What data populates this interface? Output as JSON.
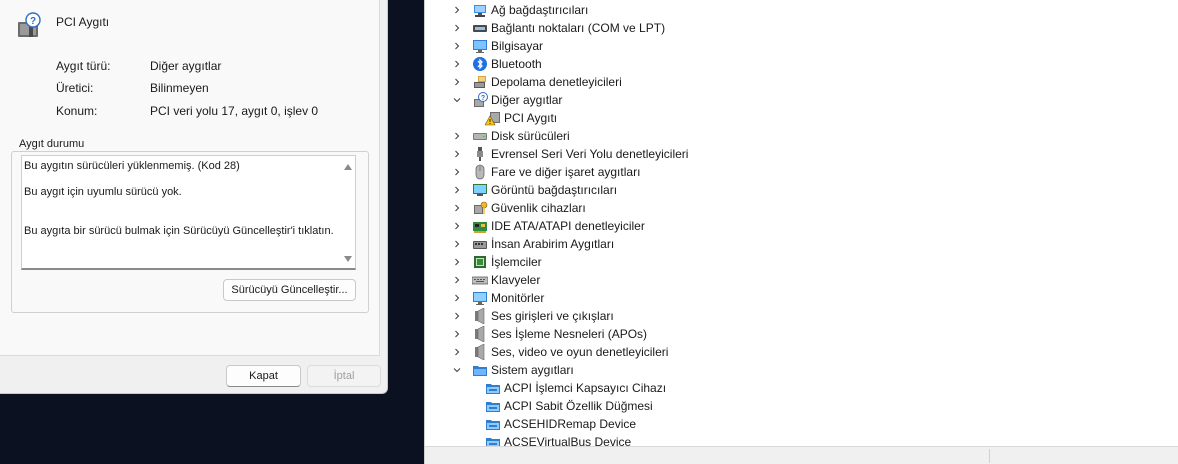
{
  "dialog": {
    "device_name": "PCI Aygıtı",
    "properties": [
      {
        "key": "Aygıt türü:",
        "value": "Diğer aygıtlar"
      },
      {
        "key": "Üretici:",
        "value": "Bilinmeyen"
      },
      {
        "key": "Konum:",
        "value": "PCI veri yolu 17, aygıt 0, işlev 0"
      }
    ],
    "status_group_title": "Aygıt durumu",
    "status_lines": [
      "Bu aygıtın sürücüleri yüklenmemiş. (Kod 28)",
      "Bu aygıt için uyumlu sürücü yok.",
      "Bu aygıta bir sürücü bulmak için Sürücüyü Güncelleştir'i tıklatın."
    ],
    "update_driver_label": "Sürücüyü Güncelleştir...",
    "close_label": "Kapat",
    "cancel_label": "İptal"
  },
  "device_manager": {
    "tree": [
      {
        "label": "Ağ bağdaştırıcıları",
        "icon": "network-adapter-icon",
        "level": 0,
        "state": "collapsed"
      },
      {
        "label": "Bağlantı noktaları (COM ve LPT)",
        "icon": "port-icon",
        "level": 0,
        "state": "collapsed"
      },
      {
        "label": "Bilgisayar",
        "icon": "computer-icon",
        "level": 0,
        "state": "collapsed"
      },
      {
        "label": "Bluetooth",
        "icon": "bluetooth-icon",
        "level": 0,
        "state": "collapsed"
      },
      {
        "label": "Depolama denetleyicileri",
        "icon": "storage-controller-icon",
        "level": 0,
        "state": "collapsed"
      },
      {
        "label": "Diğer aygıtlar",
        "icon": "unknown-device-icon",
        "level": 0,
        "state": "expanded"
      },
      {
        "label": "PCI Aygıtı",
        "icon": "warning-device-icon",
        "level": 1,
        "state": "leaf"
      },
      {
        "label": "Disk sürücüleri",
        "icon": "disk-drive-icon",
        "level": 0,
        "state": "collapsed"
      },
      {
        "label": "Evrensel Seri Veri Yolu denetleyicileri",
        "icon": "usb-icon",
        "level": 0,
        "state": "collapsed"
      },
      {
        "label": "Fare ve diğer işaret aygıtları",
        "icon": "mouse-icon",
        "level": 0,
        "state": "collapsed"
      },
      {
        "label": "Görüntü bağdaştırıcıları",
        "icon": "display-adapter-icon",
        "level": 0,
        "state": "collapsed"
      },
      {
        "label": "Güvenlik cihazları",
        "icon": "security-device-icon",
        "level": 0,
        "state": "collapsed"
      },
      {
        "label": "IDE ATA/ATAPI denetleyiciler",
        "icon": "ide-controller-icon",
        "level": 0,
        "state": "collapsed"
      },
      {
        "label": "İnsan Arabirim Aygıtları",
        "icon": "hid-icon",
        "level": 0,
        "state": "collapsed"
      },
      {
        "label": "İşlemciler",
        "icon": "processor-icon",
        "level": 0,
        "state": "collapsed"
      },
      {
        "label": "Klavyeler",
        "icon": "keyboard-icon",
        "level": 0,
        "state": "collapsed"
      },
      {
        "label": "Monitörler",
        "icon": "monitor-icon",
        "level": 0,
        "state": "collapsed"
      },
      {
        "label": "Ses girişleri ve çıkışları",
        "icon": "speaker-icon",
        "level": 0,
        "state": "collapsed"
      },
      {
        "label": "Ses İşleme Nesneleri (APOs)",
        "icon": "speaker-icon",
        "level": 0,
        "state": "collapsed"
      },
      {
        "label": "Ses, video ve oyun denetleyicileri",
        "icon": "speaker-icon",
        "level": 0,
        "state": "collapsed"
      },
      {
        "label": "Sistem aygıtları",
        "icon": "system-folder-icon",
        "level": 0,
        "state": "expanded"
      },
      {
        "label": "ACPI İşlemci Kapsayıcı Cihazı",
        "icon": "system-device-icon",
        "level": 1,
        "state": "leaf"
      },
      {
        "label": "ACPI Sabit Özellik Düğmesi",
        "icon": "system-device-icon",
        "level": 1,
        "state": "leaf"
      },
      {
        "label": "ACSEHIDRemap Device",
        "icon": "system-device-icon",
        "level": 1,
        "state": "leaf"
      },
      {
        "label": "ACSEVirtualBus Device",
        "icon": "system-device-icon",
        "level": 1,
        "state": "leaf"
      }
    ]
  }
}
